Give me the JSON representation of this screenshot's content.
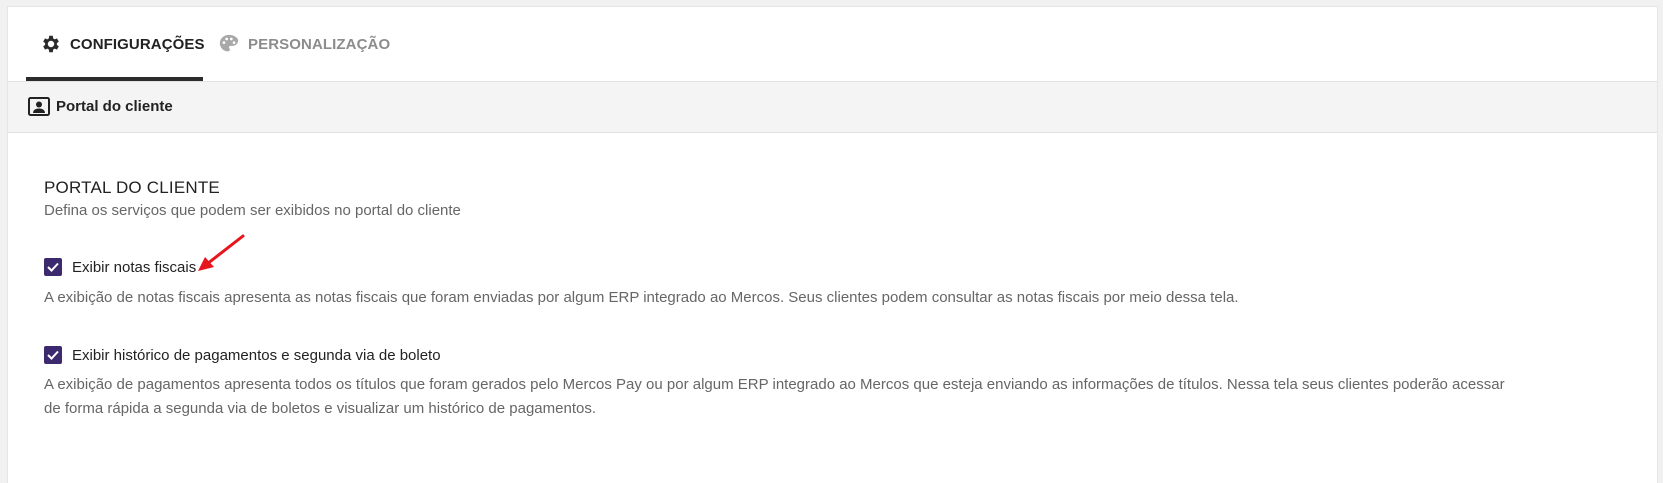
{
  "tabs": [
    {
      "label": "CONFIGURAÇÕES",
      "icon": "gear-icon",
      "active": true
    },
    {
      "label": "PERSONALIZAÇÃO",
      "icon": "palette-icon",
      "active": false
    }
  ],
  "subheader": {
    "title": "Portal do cliente",
    "icon": "portrait-icon"
  },
  "section": {
    "title": "PORTAL DO CLIENTE",
    "subtitle": "Defina os serviços que podem ser exibidos no portal do cliente"
  },
  "options": [
    {
      "label": "Exibir notas fiscais",
      "checked": true,
      "description": "A exibição de notas fiscais apresenta as notas fiscais que foram enviadas por algum ERP integrado ao Mercos. Seus clientes podem consultar as notas fiscais por meio dessa tela."
    },
    {
      "label": "Exibir histórico de pagamentos e segunda via de boleto",
      "checked": true,
      "description": "A exibição de pagamentos apresenta todos os títulos que foram gerados pelo Mercos Pay ou por algum ERP integrado ao Mercos que esteja enviando as informações de títulos. Nessa tela seus clientes poderão acessar de forma rápida a segunda via de boletos e visualizar um histórico de pagamentos."
    }
  ],
  "colors": {
    "checkbox": "#3d2a6e",
    "annotation_arrow": "#e8141b",
    "active_tab": "#222222"
  }
}
